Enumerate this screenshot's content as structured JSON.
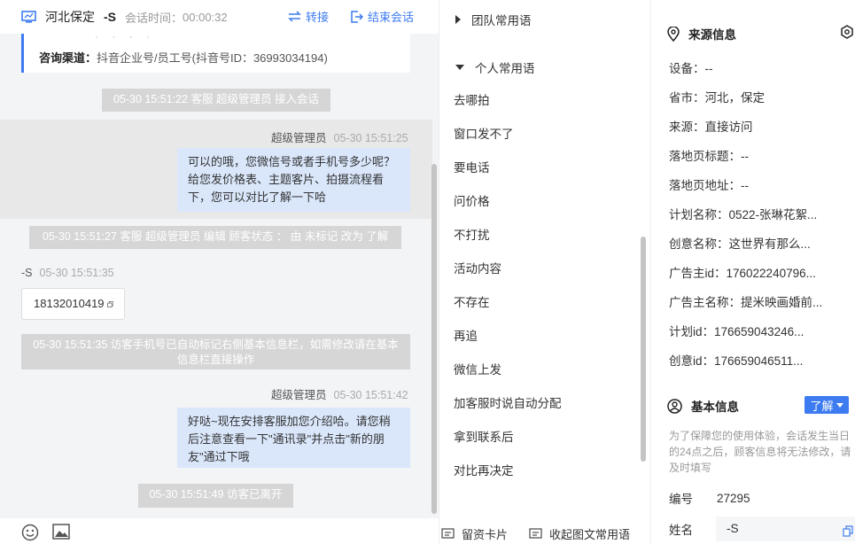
{
  "chat": {
    "header": {
      "location": "河北保定",
      "name": "-S",
      "timer_label": "会话时间：",
      "timer": "00:00:32",
      "transfer_label": "转接",
      "end_label": "结束会话"
    },
    "card": {
      "channel_label": "咨询渠道：",
      "channel_value": "抖音企业号/员工号(抖音号ID：36993034194)"
    },
    "messages": {
      "sys1": "05-30 15:51:22 客服 超级管理员 接入会话",
      "meta1_name": "超级管理员",
      "meta1_time": "05-30 15:51:25",
      "bubble1": "可以的哦，您微信号或者手机号多少呢？给您发价格表、主题客片、拍摄流程看下，您可以对比了解一下哈",
      "sys2": "05-30 15:51:27 客服 超级管理员 编辑 顾客状态 ： 由 未标记 改为 了解",
      "meta2_name": "-S",
      "meta2_time": "05-30 15:51:35",
      "phone": "18132010419",
      "sys3": "05-30 15:51:35 访客手机号已自动标记右侧基本信息栏，如需修改请在基本信息栏直接操作",
      "meta3_name": "超级管理员",
      "meta3_time": "05-30 15:51:42",
      "bubble2": "好哒~现在安排客服加您介绍哈。请您稍后注意查看一下\"通讯录\"并点击\"新的朋友\"通过下哦",
      "sys4": "05-30 15:51:49 访客已离开"
    },
    "footer_icons": [
      "emoji-icon",
      "image-icon"
    ]
  },
  "phrases": {
    "team_group": "团队常用语",
    "personal_group": "个人常用语",
    "items": [
      "去哪拍",
      "窗口发不了",
      "要电话",
      "问价格",
      "不打扰",
      "活动内容",
      "不存在",
      "再追",
      "微信上发",
      "加客服时说自动分配",
      "拿到联系后",
      "对比再决定"
    ],
    "footer_card": "留资卡片",
    "footer_collapse": "收起图文常用语"
  },
  "info": {
    "source_title": "来源信息",
    "source_items": [
      "设备：--",
      "省市：河北，保定",
      "来源：直接访问",
      "落地页标题：--",
      "落地页地址：--",
      "计划名称：0522-张琳花絮...",
      "创意名称：这世界有那么...",
      "广告主id：176022240796...",
      "广告主名称：提米映画婚前...",
      "计划id：176659043246...",
      "创意id：176659046511..."
    ],
    "basic_title": "基本信息",
    "status_button": "了解",
    "notice": "为了保障您的使用体验，会话发生当日的24点之后，顾客信息将无法修改，请及时填写",
    "id_label": "编号",
    "id_value": "27295",
    "name_label": "姓名",
    "name_value": "-S"
  },
  "colors": {
    "accent": "#3d7bf0",
    "bubble": "#dae7fb",
    "system": "#d6d6d6"
  }
}
